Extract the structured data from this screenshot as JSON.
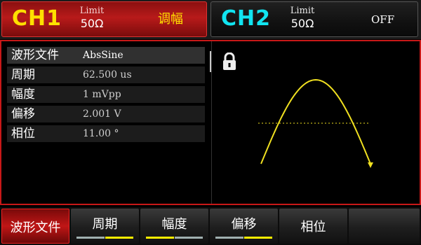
{
  "ch1": {
    "name": "CH1",
    "limit_label": "Limit",
    "impedance": "50Ω",
    "mode": "调幅"
  },
  "ch2": {
    "name": "CH2",
    "limit_label": "Limit",
    "impedance": "50Ω",
    "state": "OFF"
  },
  "params": [
    {
      "label": "波形文件",
      "value": "AbsSine"
    },
    {
      "label": "周期",
      "value": "62.500 us"
    },
    {
      "label": "幅度",
      "value": "1 mVpp"
    },
    {
      "label": "偏移",
      "value": "2.001 V"
    },
    {
      "label": "相位",
      "value": "11.00 °"
    }
  ],
  "preview": {
    "lock_icon": "padlock-icon",
    "waveform": "abs-sine",
    "colors": {
      "trace": "#f0e020",
      "centerline": "#f0e020"
    }
  },
  "softkeys": [
    {
      "label": "波形文件"
    },
    {
      "label": "周期"
    },
    {
      "label": "幅度"
    },
    {
      "label": "偏移"
    },
    {
      "label": "相位"
    }
  ],
  "colors": {
    "ch1_accent": "#ffe000",
    "ch2_accent": "#11e4f0",
    "active_red": "#c01616",
    "indicator_yellow": "#ffef00",
    "indicator_gray": "#a0b0b0"
  }
}
